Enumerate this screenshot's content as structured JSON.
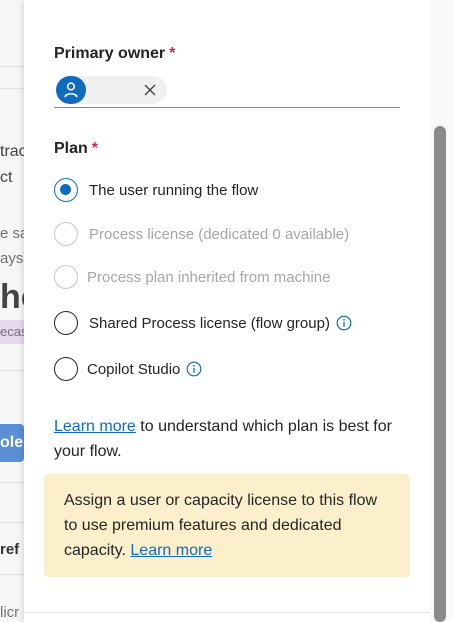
{
  "background": {
    "fragments": [
      "trac",
      "ct",
      "e sa",
      "ays)",
      "ho",
      "ecas",
      "ole",
      "ref",
      "licr"
    ]
  },
  "owner": {
    "label": "Primary owner",
    "required_mark": "*",
    "chip_avatar_icon": "person-icon",
    "remove_icon": "close-icon"
  },
  "plan": {
    "label": "Plan",
    "required_mark": "*",
    "options": [
      {
        "label": "The user running the flow",
        "checked": true,
        "disabled": false
      },
      {
        "label": "Process license (dedicated 0 available)",
        "checked": false,
        "disabled": true
      },
      {
        "label": "Process plan inherited from machine",
        "checked": false,
        "disabled": true
      },
      {
        "label": "Shared Process license (flow group)",
        "checked": false,
        "disabled": false,
        "info": true
      },
      {
        "label": "Copilot Studio",
        "checked": false,
        "disabled": false,
        "info": true
      }
    ]
  },
  "learn": {
    "link": "Learn more",
    "text": " to understand which plan is best for your flow."
  },
  "notice": {
    "text": "Assign a user or capacity license to this flow to use premium features and dedicated capacity. ",
    "link": "Learn more"
  },
  "colors": {
    "accent": "#0f6cbd",
    "required": "#c4314b",
    "notice_bg": "#fcf0cc"
  }
}
